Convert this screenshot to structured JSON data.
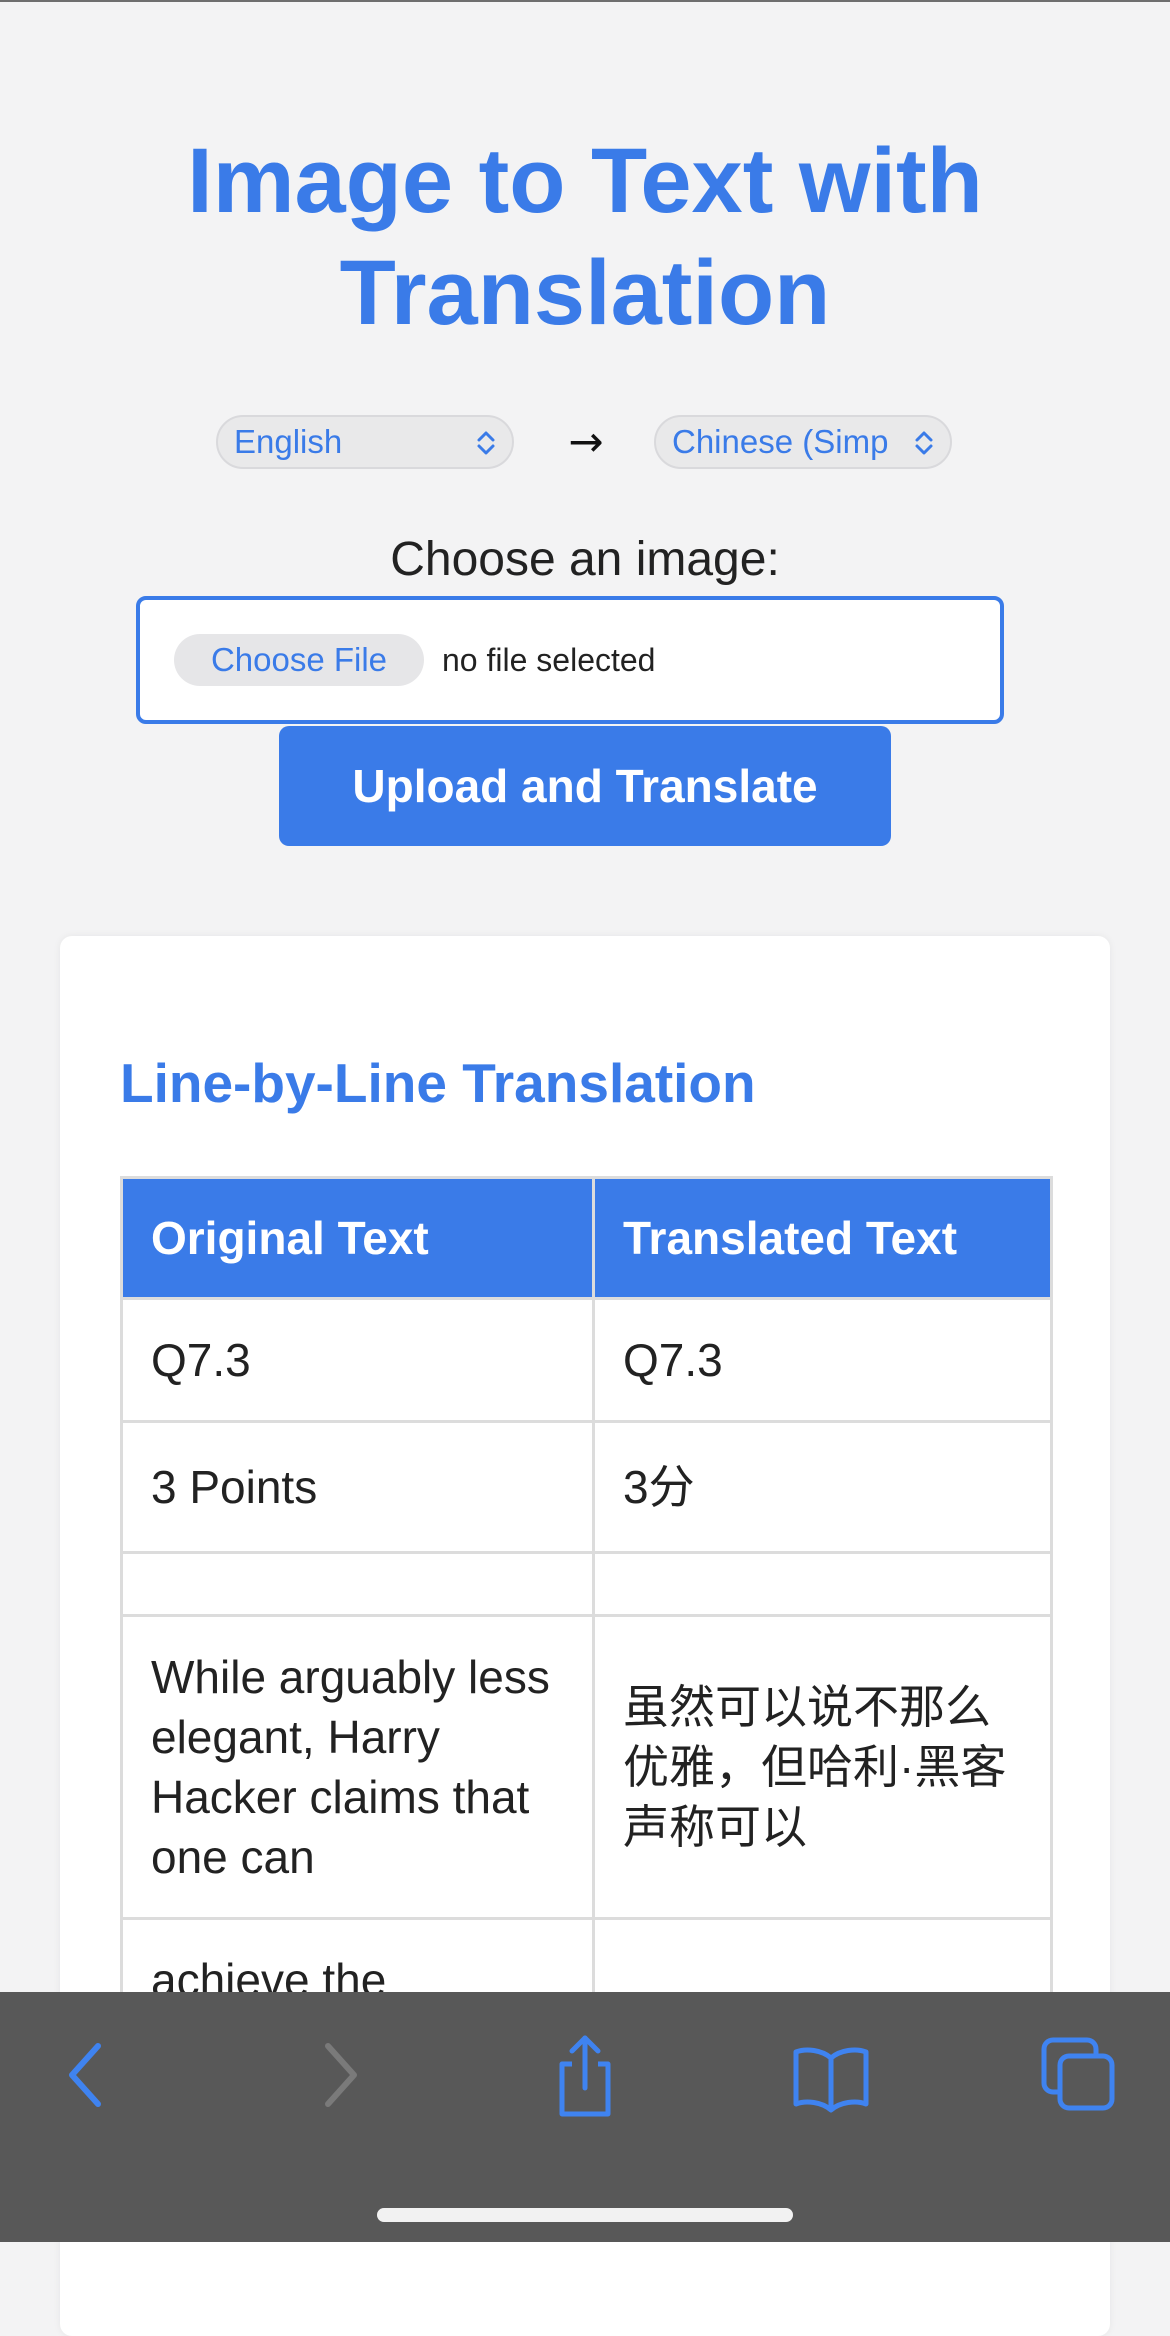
{
  "page": {
    "title": "Image to Text with Translation"
  },
  "languages": {
    "source": "English",
    "target": "Chinese (Simp",
    "arrow": "→"
  },
  "upload": {
    "label": "Choose an image:",
    "file_button": "Choose File",
    "file_status": "no file selected",
    "submit": "Upload and Translate"
  },
  "results": {
    "heading": "Line-by-Line Translation",
    "columns": [
      "Original Text",
      "Translated Text"
    ],
    "rows": [
      {
        "original": "Q7.3",
        "translated": "Q7.3"
      },
      {
        "original": "3 Points",
        "translated": "3分"
      },
      {
        "original": "",
        "translated": ""
      },
      {
        "original": "While arguably less elegant, Harry Hacker claims that one can",
        "translated": "虽然可以说不那么优雅，但哈利·黑客声称可以"
      },
      {
        "original": "achieve the",
        "translated": ""
      }
    ]
  },
  "toolbar": {
    "icons": [
      "back-icon",
      "forward-icon",
      "share-icon",
      "bookmarks-icon",
      "tabs-icon"
    ]
  },
  "colors": {
    "accent": "#3a7be8",
    "background": "#f3f3f4",
    "toolbar": "#585858"
  }
}
